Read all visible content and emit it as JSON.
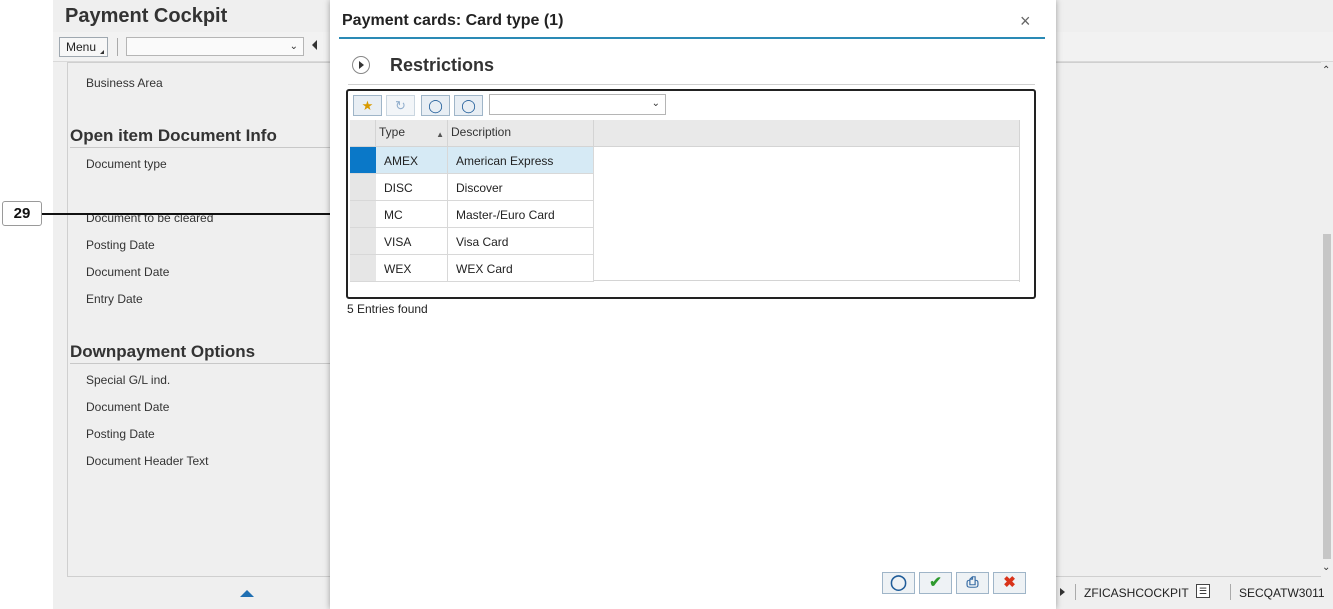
{
  "app": {
    "title": "Payment Cockpit",
    "menu_label": "Menu",
    "toolbar_select_value": "",
    "fields_top": [
      "Business Area"
    ],
    "sections": [
      {
        "title": "Open item Document Info",
        "fields": [
          "Document type",
          "Document to be cleared",
          "Posting Date",
          "Document Date",
          "Entry Date"
        ]
      },
      {
        "title": "Downpayment Options",
        "fields": [
          "Special G/L ind.",
          "Document Date",
          "Posting Date",
          "Document Header Text"
        ]
      }
    ],
    "status": {
      "transaction": "ZFICASHCOCKPIT",
      "system": "SECQATW3011"
    }
  },
  "callout": {
    "number": "29"
  },
  "dialog": {
    "title": "Payment cards: Card type (1)",
    "close_symbol": "×",
    "restrictions_label": "Restrictions",
    "grid": {
      "toolbar_icons": [
        "filter-icon",
        "find-next-icon",
        "find-icon",
        "find-next-binoculars-icon"
      ],
      "toolbar_select_value": "",
      "columns": [
        "Type",
        "Description"
      ],
      "rows": [
        {
          "type": "AMEX",
          "description": "American Express"
        },
        {
          "type": "DISC",
          "description": "Discover"
        },
        {
          "type": "MC",
          "description": "Master-/Euro Card"
        },
        {
          "type": "VISA",
          "description": "Visa Card"
        },
        {
          "type": "WEX",
          "description": "WEX Card"
        }
      ],
      "selected_row": 0
    },
    "entries_found": "5 Entries found",
    "footer_buttons": [
      "search-icon",
      "confirm-icon",
      "print-icon",
      "cancel-icon"
    ]
  },
  "colors": {
    "accent": "#2a8ab5",
    "selection": "#0a78c8",
    "selected_row_bg": "#d6eaf5",
    "confirm": "#2e9a2e",
    "cancel": "#d9331a"
  }
}
